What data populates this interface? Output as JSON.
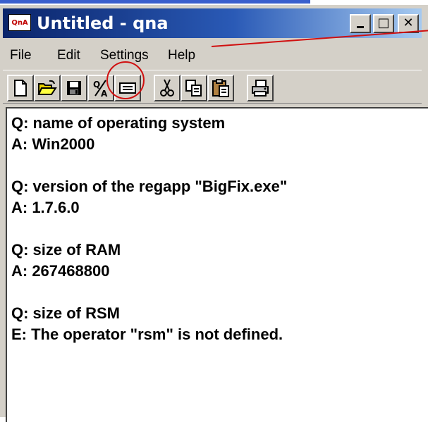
{
  "window": {
    "title": "Untitled - qna",
    "icon_text": "QnA",
    "controls": {
      "minimize_label": "",
      "maximize_label": "□",
      "close_label": "✕"
    }
  },
  "menu": [
    "File",
    "Edit",
    "Settings",
    "Help"
  ],
  "toolbar": {
    "icons": [
      "new-document-icon",
      "open-folder-icon",
      "save-disk-icon",
      "qa-icon",
      "form-icon",
      "cut-icon",
      "copy-icon",
      "paste-icon",
      "print-icon"
    ],
    "qa_label": "Q/A"
  },
  "content": {
    "lines": [
      "Q: name of operating system",
      "A: Win2000",
      "",
      "Q: version of the regapp \"BigFix.exe\"",
      "A: 1.7.6.0",
      "",
      "Q: size of RAM",
      "A: 267468800",
      "",
      "Q: size of RSM",
      "E: The operator \"rsm\" is not defined."
    ]
  },
  "colors": {
    "title_gradient_start": "#0a246a",
    "title_gradient_end": "#a6caf0",
    "face": "#d4d0c8",
    "annotation_red": "#d01010"
  }
}
